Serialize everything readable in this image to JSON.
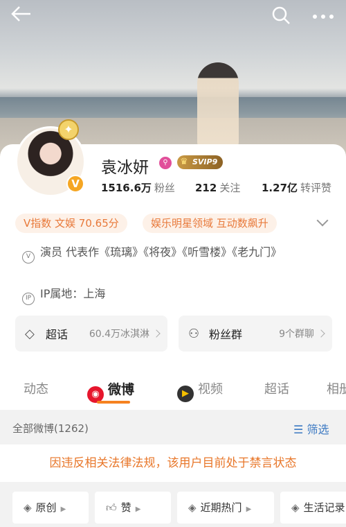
{
  "header": {
    "back_icon": "arrow-left-icon",
    "search_icon": "search-icon",
    "more_icon": "more-icon"
  },
  "profile": {
    "name": "袁冰妍",
    "badge": "SVIP9",
    "stats": [
      {
        "value": "1516.6万",
        "label": "粉丝"
      },
      {
        "value": "212",
        "label": "关注"
      },
      {
        "value": "1.27亿",
        "label": "转评赞"
      }
    ],
    "chips": [
      "V指数 文娱 70.65分",
      "娱乐明星领域 互动数飙升"
    ],
    "works": "演员 代表作《琉璃》《将夜》《听雪楼》《老九门》",
    "ip": "IP属地：上海"
  },
  "tiles": [
    {
      "label": "超话",
      "detail": "60.4万冰淇淋"
    },
    {
      "label": "粉丝群",
      "detail": "9个群聊"
    }
  ],
  "tabs": [
    "动态",
    "微博",
    "视频",
    "超话",
    "相册"
  ],
  "filter": {
    "all": "全部微博(1262)",
    "button": "筛选"
  },
  "notice": "因违反相关法律法规，该用户目前处于禁言状态",
  "pills": [
    "原创",
    "赞",
    "近期热门",
    "生活记录"
  ],
  "colors": {
    "accent": "#f58220",
    "link": "#3a78c2",
    "notice": "#e8772a"
  }
}
